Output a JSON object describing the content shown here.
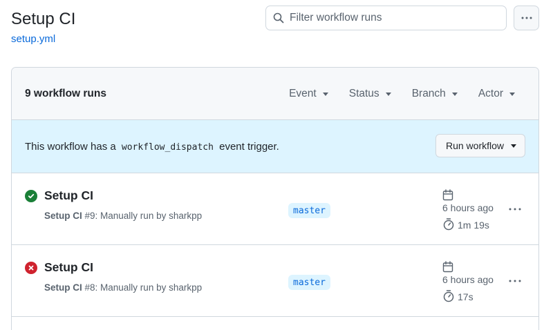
{
  "header": {
    "title": "Setup CI",
    "workflow_file": "setup.yml",
    "filter_placeholder": "Filter workflow runs"
  },
  "runs_header": {
    "count_label": "9 workflow runs",
    "filters": [
      {
        "label": "Event"
      },
      {
        "label": "Status"
      },
      {
        "label": "Branch"
      },
      {
        "label": "Actor"
      }
    ]
  },
  "banner": {
    "text_before": "This workflow has a",
    "code": "workflow_dispatch",
    "text_after": "event trigger.",
    "button_label": "Run workflow"
  },
  "runs": [
    {
      "status": "success",
      "status_icon": "check-circle-fill-icon",
      "title": "Setup CI",
      "workflow_name": "Setup CI",
      "meta": " #9: Manually run by sharkpp",
      "branch": "master",
      "time_ago": "6 hours ago",
      "duration": "1m 19s"
    },
    {
      "status": "failure",
      "status_icon": "x-circle-fill-icon",
      "title": "Setup CI",
      "workflow_name": "Setup CI",
      "meta": " #8: Manually run by sharkpp",
      "branch": "master",
      "time_ago": "6 hours ago",
      "duration": "17s"
    }
  ],
  "colors": {
    "success": "#1a7f37",
    "failure": "#cf222e",
    "link": "#0969da",
    "banner_bg": "#ddf4ff",
    "header_bg": "#f6f8fa",
    "border": "#d0d7de"
  }
}
